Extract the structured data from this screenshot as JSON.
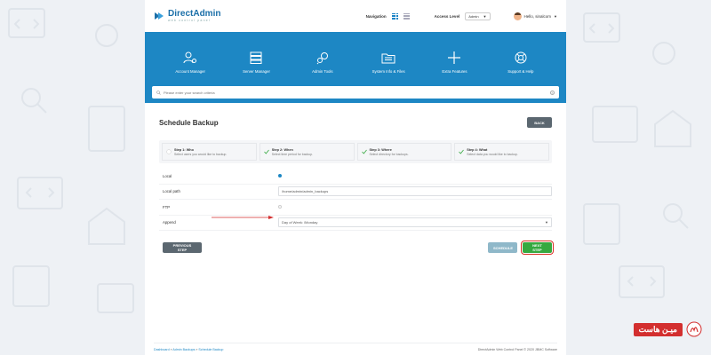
{
  "brand": {
    "title": "DirectAdmin",
    "subtitle": "web control panel",
    "color": "#1b6fa8"
  },
  "topbar": {
    "navigation_label": "Navigation",
    "access_level_label": "Access Level",
    "access_level_value": "Admin",
    "user_greeting": "Hello, sinalcom"
  },
  "menu": {
    "items": [
      {
        "label": "Account Manager",
        "icon": "user-gear-icon"
      },
      {
        "label": "Server Manager",
        "icon": "server-icon"
      },
      {
        "label": "Admin Tools",
        "icon": "tools-icon"
      },
      {
        "label": "System Info & Files",
        "icon": "folder-icon"
      },
      {
        "label": "Extra Features",
        "icon": "plus-icon"
      },
      {
        "label": "Support & Help",
        "icon": "lifebuoy-icon"
      }
    ],
    "background": "#1d87c4"
  },
  "search": {
    "placeholder": "Please enter your search criteria"
  },
  "page": {
    "title": "Schedule Backup",
    "back_label": "BACK"
  },
  "steps": [
    {
      "title": "Step 1: Who",
      "desc": "Select users you would like to backup.",
      "checked": false
    },
    {
      "title": "Step 2: When",
      "desc": "Select time period for backup.",
      "checked": true
    },
    {
      "title": "Step 3: Where",
      "desc": "Select directory for backups.",
      "checked": true
    },
    {
      "title": "Step 4: What",
      "desc": "Select data you would like to backup.",
      "checked": true
    }
  ],
  "form": {
    "local_label": "Local",
    "local_path_label": "Local path",
    "local_path_value": "/home/admin/admin_backups",
    "ftp_label": "FTP",
    "append_label": "Append",
    "append_value": "Day of Week: /Monday"
  },
  "actions": {
    "previous_label": "PREVIOUS STEP",
    "schedule_label": "SCHEDULE",
    "next_label": "NEXT STEP"
  },
  "footer": {
    "crumb_1": "Dashboard",
    "crumb_2": "Admin Backups",
    "crumb_3": "Schedule Backup",
    "sep": "»",
    "copyright": "DirectAdmin Web Control Panel © 2020 JBMC Software"
  },
  "watermark": {
    "text": "میـن هاست"
  }
}
